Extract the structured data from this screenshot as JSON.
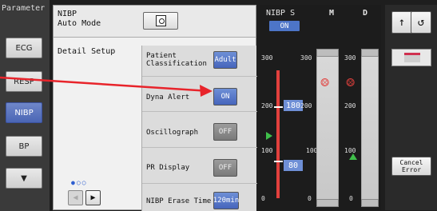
{
  "sidebar": {
    "title": "Parameter",
    "items": [
      {
        "label": "ECG",
        "active": false
      },
      {
        "label": "RESP",
        "active": false
      },
      {
        "label": "NIBP",
        "active": true
      },
      {
        "label": "BP",
        "active": false
      },
      {
        "label": "▼",
        "active": false
      }
    ]
  },
  "main": {
    "header_title": "NIBP\nAuto Mode",
    "detail_title": "Detail Setup",
    "settings": [
      {
        "label": "Patient\nClassification",
        "value": "Adult",
        "style": "blue"
      },
      {
        "label": "Dyna Alert",
        "value": "ON",
        "style": "blue"
      },
      {
        "label": "Oscillograph",
        "value": "OFF",
        "style": "gray"
      },
      {
        "label": "PR Display",
        "value": "OFF",
        "style": "gray"
      },
      {
        "label": "NIBP Erase Time",
        "value": "120min",
        "style": "blue"
      }
    ],
    "page_dots": "●○○",
    "prev_label": "◀",
    "next_label": "▶"
  },
  "nibp_panel": {
    "title_s": "NIBP S",
    "title_m": "M",
    "title_d": "D",
    "status": "ON",
    "s_ticks": [
      "300",
      "200",
      "100",
      "0"
    ],
    "m_ticks": [
      "300",
      "200",
      "100",
      "0"
    ],
    "d_ticks": [
      "300",
      "200",
      "100",
      "0"
    ],
    "upper_limit": "180",
    "lower_limit": "80",
    "colors": {
      "accent": "#4d75c8",
      "alarm": "#e2403d",
      "indicator": "#3fbf4a"
    }
  },
  "right_col": {
    "up_label": "↑",
    "back_label": "↺",
    "cancel_label": "Cancel\nError"
  }
}
